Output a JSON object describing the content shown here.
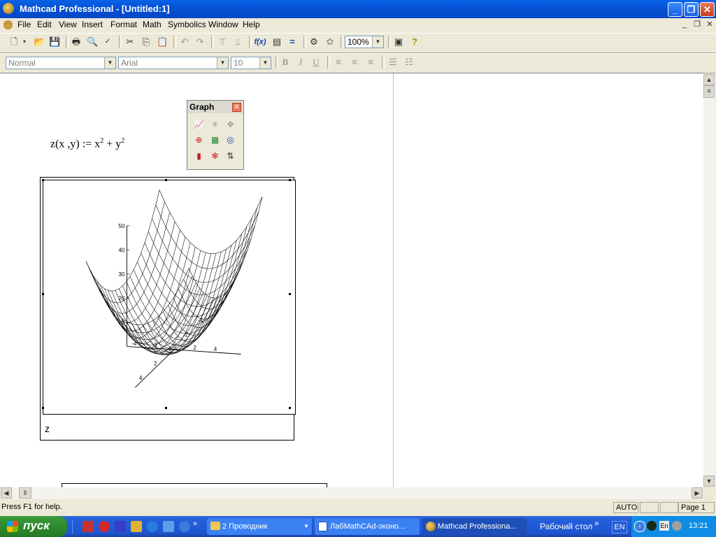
{
  "window": {
    "title": "Mathcad Professional - [Untitled:1]"
  },
  "menu": [
    "File",
    "Edit",
    "View",
    "Insert",
    "Format",
    "Math",
    "Symbolics",
    "Window",
    "Help"
  ],
  "toolbar": {
    "zoom": "100%",
    "fx_label": "f(x)"
  },
  "format_bar": {
    "style": "Normal",
    "font": "Arial",
    "size": "10",
    "bold": "B",
    "italic": "I",
    "underline": "U"
  },
  "graph_palette": {
    "title": "Graph"
  },
  "worksheet": {
    "formula": {
      "lhs": "z(x ,y) := x",
      "exp1": "2",
      "mid": " + y",
      "exp2": "2"
    },
    "plot_label": "z"
  },
  "chart_data": {
    "type": "surface",
    "function": "z = x^2 + y^2",
    "z_ticks": [
      "50",
      "40",
      "30",
      "20",
      "10"
    ],
    "x_ticks": [
      "4",
      "2",
      "0",
      "-2",
      "-4"
    ],
    "y_ticks": [
      "-4",
      "-2",
      "0",
      "2",
      "4"
    ],
    "zlim": [
      0,
      50
    ],
    "grid": "wireframe"
  },
  "status": {
    "help": "Press F1 for help.",
    "mode": "AUTO",
    "page": "Page 1"
  },
  "taskbar": {
    "start": "пуск",
    "tasks": [
      {
        "label": "2 Проводник",
        "active": false
      },
      {
        "label": "ЛабMathCAd-эконо...",
        "active": false
      },
      {
        "label": "Mathcad Professiona...",
        "active": true
      }
    ],
    "desktop": "Рабочий стол",
    "lang": "EN",
    "clock": "13:21"
  }
}
